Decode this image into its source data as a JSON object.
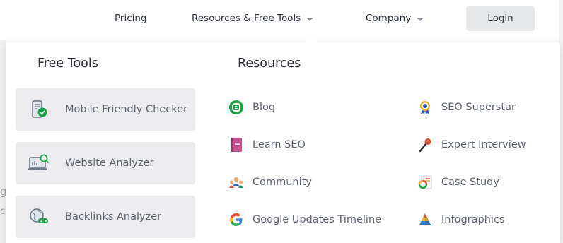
{
  "nav": {
    "pricing": "Pricing",
    "resources": "Resources & Free Tools",
    "company": "Company",
    "login": "Login"
  },
  "background": {
    "char1": "g",
    "char2": "c"
  },
  "dropdown": {
    "free_tools_title": "Free Tools",
    "resources_title": "Resources",
    "tools": [
      {
        "label": "Mobile Friendly Checker",
        "icon": "mobile-check-icon"
      },
      {
        "label": "Website Analyzer",
        "icon": "website-analyzer-icon"
      },
      {
        "label": "Backlinks Analyzer",
        "icon": "backlinks-icon"
      }
    ],
    "resources_col1": [
      {
        "label": "Blog",
        "icon": "blog-icon"
      },
      {
        "label": "Learn SEO",
        "icon": "book-icon"
      },
      {
        "label": "Community",
        "icon": "community-icon"
      },
      {
        "label": "Google Updates Timeline",
        "icon": "google-icon"
      }
    ],
    "resources_col2": [
      {
        "label": "SEO Superstar",
        "icon": "award-badge-icon"
      },
      {
        "label": "Expert Interview",
        "icon": "microphone-icon"
      },
      {
        "label": "Case Study",
        "icon": "case-study-icon"
      },
      {
        "label": "Infographics",
        "icon": "pyramid-icon"
      }
    ]
  },
  "colors": {
    "login_bg": "#e7e8ea",
    "card_bg": "#ececee",
    "blog_green": "#1aa34a",
    "google_blue": "#4285f4"
  }
}
